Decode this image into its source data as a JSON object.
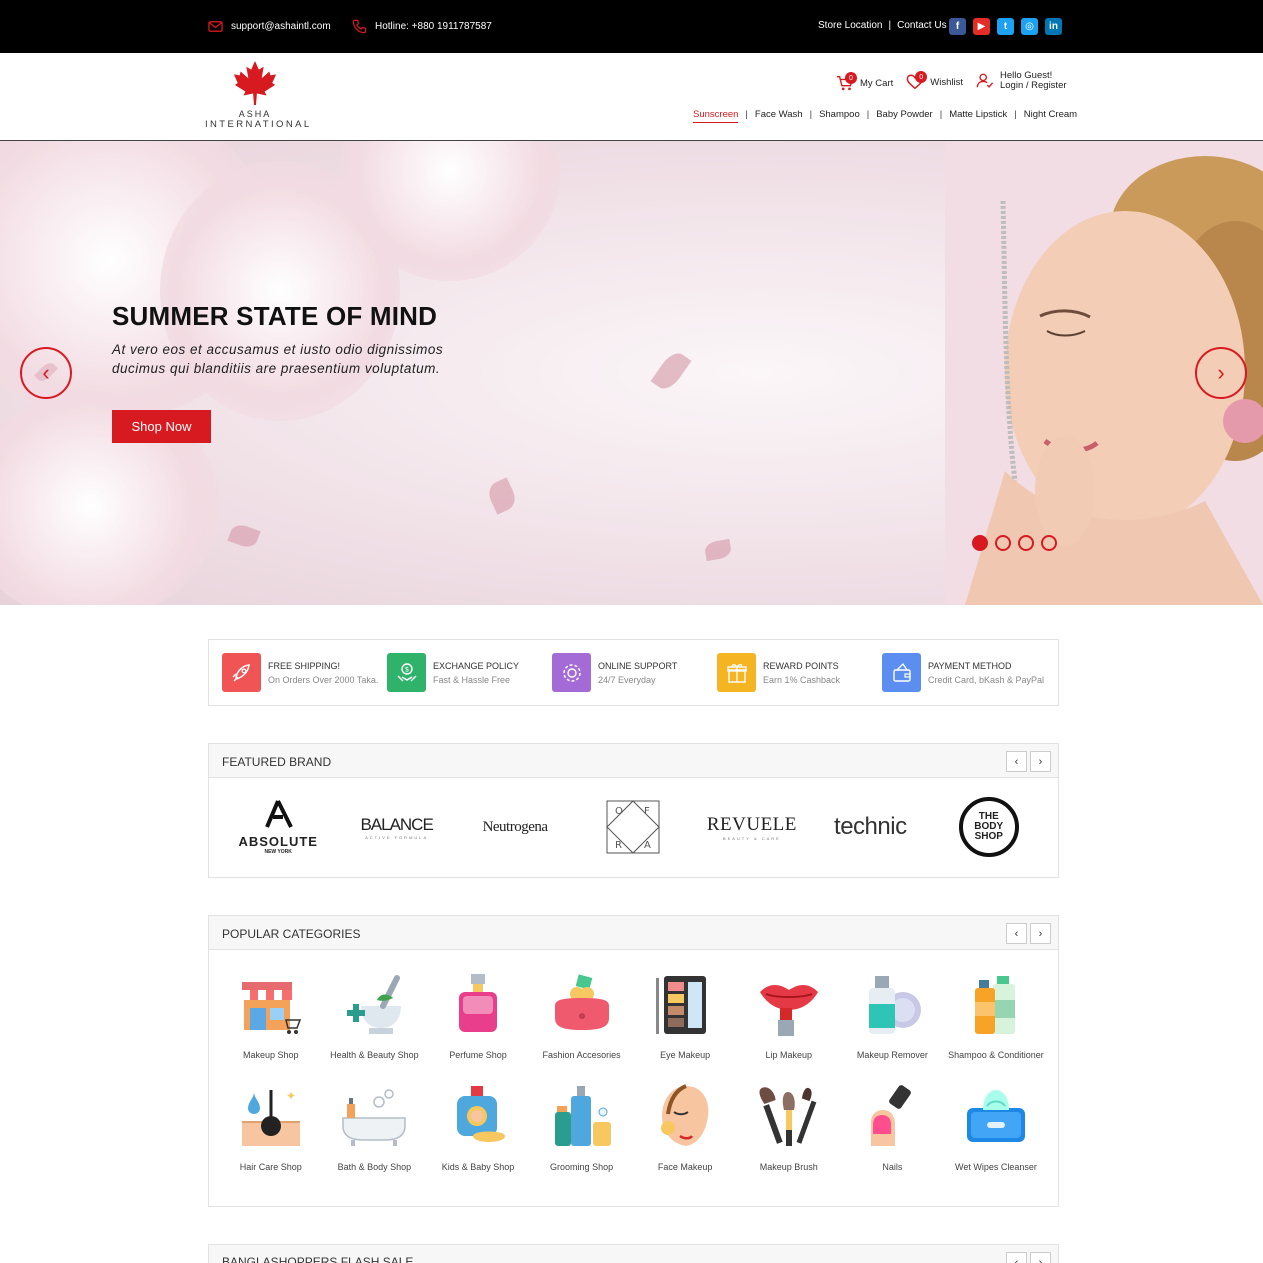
{
  "topbar": {
    "email": "support@ashaintl.com",
    "hotline": "Hotline: +880 1911787587",
    "store_location": "Store Location",
    "separator": "|",
    "contact_us": "Contact Us",
    "socials": [
      "f",
      "▶",
      "t",
      "◎",
      "in"
    ]
  },
  "header": {
    "logo_line1": "ASHA",
    "logo_line2": "INTERNATIONAL",
    "cart_count": "0",
    "cart_label": "My Cart",
    "wishlist_count": "0",
    "wishlist_label": "Wishlist",
    "greeting": "Hello Guest!",
    "login_register": "Login / Register",
    "nav": [
      "Sunscreen",
      "Face Wash",
      "Shampoo",
      "Baby Powder",
      "Matte Lipstick",
      "Night Cream"
    ],
    "active_nav": "Sunscreen"
  },
  "hero": {
    "title": "SUMMER STATE OF MIND",
    "text": "At vero eos et accusamus et iusto odio dignissimos ducimus qui blanditiis are praesentium voluptatum.",
    "cta": "Shop Now",
    "slide_count": 4,
    "active_slide": 1
  },
  "features": [
    {
      "title": "FREE SHIPPING!",
      "sub": "On Orders Over 2000 Taka.",
      "color": "#f05454",
      "icon": "rocket-icon"
    },
    {
      "title": "EXCHANGE POLICY",
      "sub": "Fast & Hassle Free",
      "color": "#2fb36b",
      "icon": "money-hand-icon"
    },
    {
      "title": "ONLINE SUPPORT",
      "sub": "24/7 Everyday",
      "color": "#a46ad6",
      "icon": "support-gear-icon"
    },
    {
      "title": "REWARD POINTS",
      "sub": "Earn 1% Cashback",
      "color": "#f5b522",
      "icon": "gift-icon"
    },
    {
      "title": "PAYMENT METHOD",
      "sub": "Credit Card, bKash & PayPal",
      "color": "#5b8ef0",
      "icon": "wallet-icon"
    }
  ],
  "featured_brand": {
    "title": "FEATURED BRAND",
    "prev": "‹",
    "next": "›",
    "brands": [
      {
        "name": "ABSOLUTE",
        "sub": "NEW YORK"
      },
      {
        "name": "BALANCE",
        "sub": "ACTIVE FORMULA"
      },
      {
        "name": "Neutrogena",
        "sub": ""
      },
      {
        "name": "OFRA",
        "sub": ""
      },
      {
        "name": "REVUELE",
        "sub": "BEAUTY & CARE"
      },
      {
        "name": "technic",
        "sub": ""
      },
      {
        "name": "THE BODY SHOP",
        "sub": ""
      }
    ]
  },
  "popular_categories": {
    "title": "POPULAR CATEGORIES",
    "prev": "‹",
    "next": "›",
    "items": [
      {
        "label": "Makeup Shop",
        "icon": "shop-icon"
      },
      {
        "label": "Health & Beauty Shop",
        "icon": "mortar-icon"
      },
      {
        "label": "Perfume Shop",
        "icon": "perfume-icon"
      },
      {
        "label": "Fashion Accesories",
        "icon": "purse-icon"
      },
      {
        "label": "Eye Makeup",
        "icon": "eyeshadow-palette-icon"
      },
      {
        "label": "Lip Makeup",
        "icon": "lipstick-icon"
      },
      {
        "label": "Makeup Remover",
        "icon": "remover-bottle-icon"
      },
      {
        "label": "Shampoo & Conditioner",
        "icon": "shampoo-bottles-icon"
      },
      {
        "label": "Hair Care Shop",
        "icon": "hair-follicle-icon"
      },
      {
        "label": "Bath & Body Shop",
        "icon": "bathtub-icon"
      },
      {
        "label": "Kids & Baby Shop",
        "icon": "baby-bottle-icon"
      },
      {
        "label": "Grooming Shop",
        "icon": "grooming-bottles-icon"
      },
      {
        "label": "Face Makeup",
        "icon": "face-makeup-icon"
      },
      {
        "label": "Makeup Brush",
        "icon": "makeup-brush-icon"
      },
      {
        "label": "Nails",
        "icon": "nail-polish-icon"
      },
      {
        "label": "Wet Wipes Cleanser",
        "icon": "wet-wipes-icon"
      }
    ]
  },
  "flash_sale": {
    "title": "BANGLASHOPPERS FLASH SALE"
  },
  "colors": {
    "accent": "#d71920",
    "topbar": "#000000"
  }
}
